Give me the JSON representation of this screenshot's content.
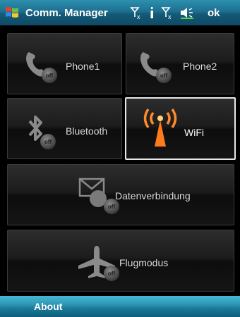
{
  "titlebar": {
    "title": "Comm. Manager",
    "ok_label": "ok",
    "icons": [
      "windows-start-icon",
      "data-connection-off-icon",
      "signal-bars-icon",
      "signal-off-icon",
      "volume-icon"
    ]
  },
  "tiles": {
    "phone1": {
      "label": "Phone1",
      "badge": "off",
      "icon": "phone-icon"
    },
    "phone2": {
      "label": "Phone2",
      "badge": "off",
      "icon": "phone-icon"
    },
    "bluetooth": {
      "label": "Bluetooth",
      "badge": "off",
      "icon": "bluetooth-icon"
    },
    "wifi": {
      "label": "WiFi",
      "icon": "wifi-antenna-icon",
      "state": "on",
      "accent": "#ff7a1a"
    },
    "data": {
      "label": "Datenverbindung",
      "badge": "off",
      "icon": "envelope-globe-icon"
    },
    "flight": {
      "label": "Flugmodus",
      "badge": "off",
      "icon": "airplane-icon"
    }
  },
  "bottombar": {
    "about_label": "About"
  }
}
